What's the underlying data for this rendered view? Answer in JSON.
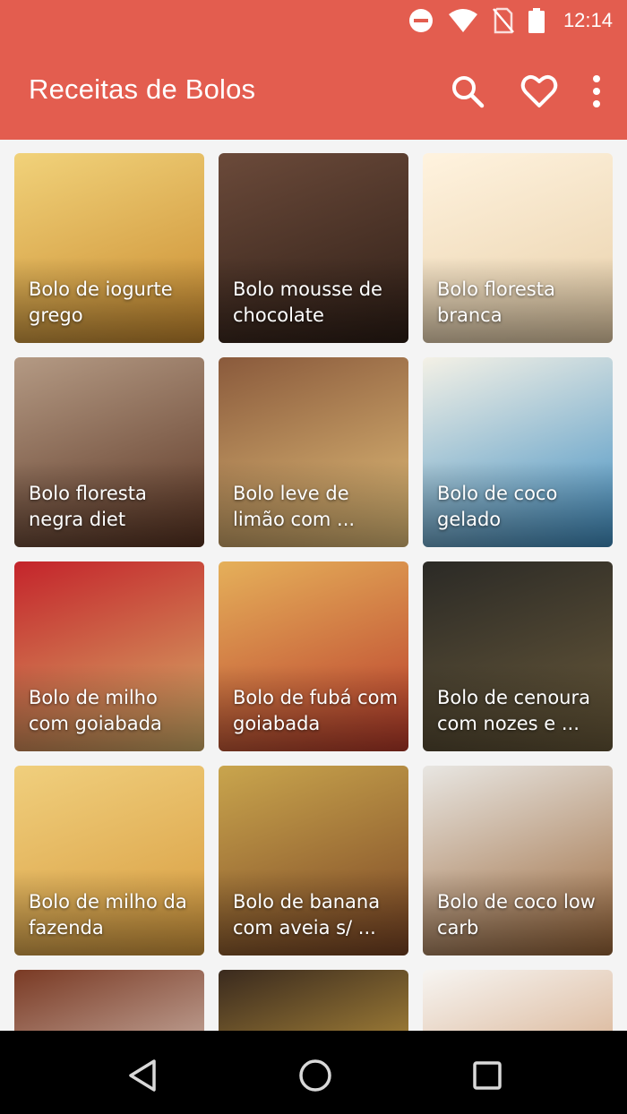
{
  "status_bar": {
    "time": "12:14",
    "icons": [
      "do-not-disturb-icon",
      "wifi-icon",
      "no-sim-icon",
      "battery-icon"
    ]
  },
  "app_bar": {
    "title": "Receitas de Bolos",
    "actions": [
      "search-icon",
      "heart-icon",
      "more-vert-icon"
    ]
  },
  "recipes": [
    {
      "label": "Bolo de iogurte grego",
      "color_top": "#f1d27a",
      "color_bottom": "#c98a2e"
    },
    {
      "label": "Bolo mousse de chocolate",
      "color_top": "#6b4a3a",
      "color_bottom": "#2e1e16"
    },
    {
      "label": "Bolo floresta branca",
      "color_top": "#fff3df",
      "color_bottom": "#e8cfa8"
    },
    {
      "label": "Bolo floresta negra diet",
      "color_top": "#b49a84",
      "color_bottom": "#5a3422"
    },
    {
      "label": "Bolo leve de limão com ...",
      "color_top": "#8a5a3c",
      "color_bottom": "#e4c07a"
    },
    {
      "label": "Bolo de coco gelado",
      "color_top": "#f4f1e6",
      "color_bottom": "#3f8ec2"
    },
    {
      "label": "Bolo de milho com goiabada",
      "color_top": "#c4242b",
      "color_bottom": "#d7b26a"
    },
    {
      "label": "Bolo de fubá com goiabada",
      "color_top": "#e5b05a",
      "color_bottom": "#b93a2a"
    },
    {
      "label": "Bolo de cenoura com nozes e ...",
      "color_top": "#2b2a26",
      "color_bottom": "#6a5a3a"
    },
    {
      "label": "Bolo de milho da fazenda",
      "color_top": "#f0cf7d",
      "color_bottom": "#d79a3d"
    },
    {
      "label": "Bolo de banana com aveia s/ ...",
      "color_top": "#c9a54d",
      "color_bottom": "#7a4424"
    },
    {
      "label": "Bolo de coco low carb",
      "color_top": "#e8e6e2",
      "color_bottom": "#9a6638"
    },
    {
      "label": "",
      "color_top": "#7a3a24",
      "color_bottom": "#f4f0ea"
    },
    {
      "label": "",
      "color_top": "#3a2a1e",
      "color_bottom": "#f0c04a"
    },
    {
      "label": "",
      "color_top": "#f7f5f2",
      "color_bottom": "#c68a5a"
    }
  ],
  "nav_bar": {
    "buttons": [
      "back-icon",
      "home-icon",
      "recents-icon"
    ]
  }
}
